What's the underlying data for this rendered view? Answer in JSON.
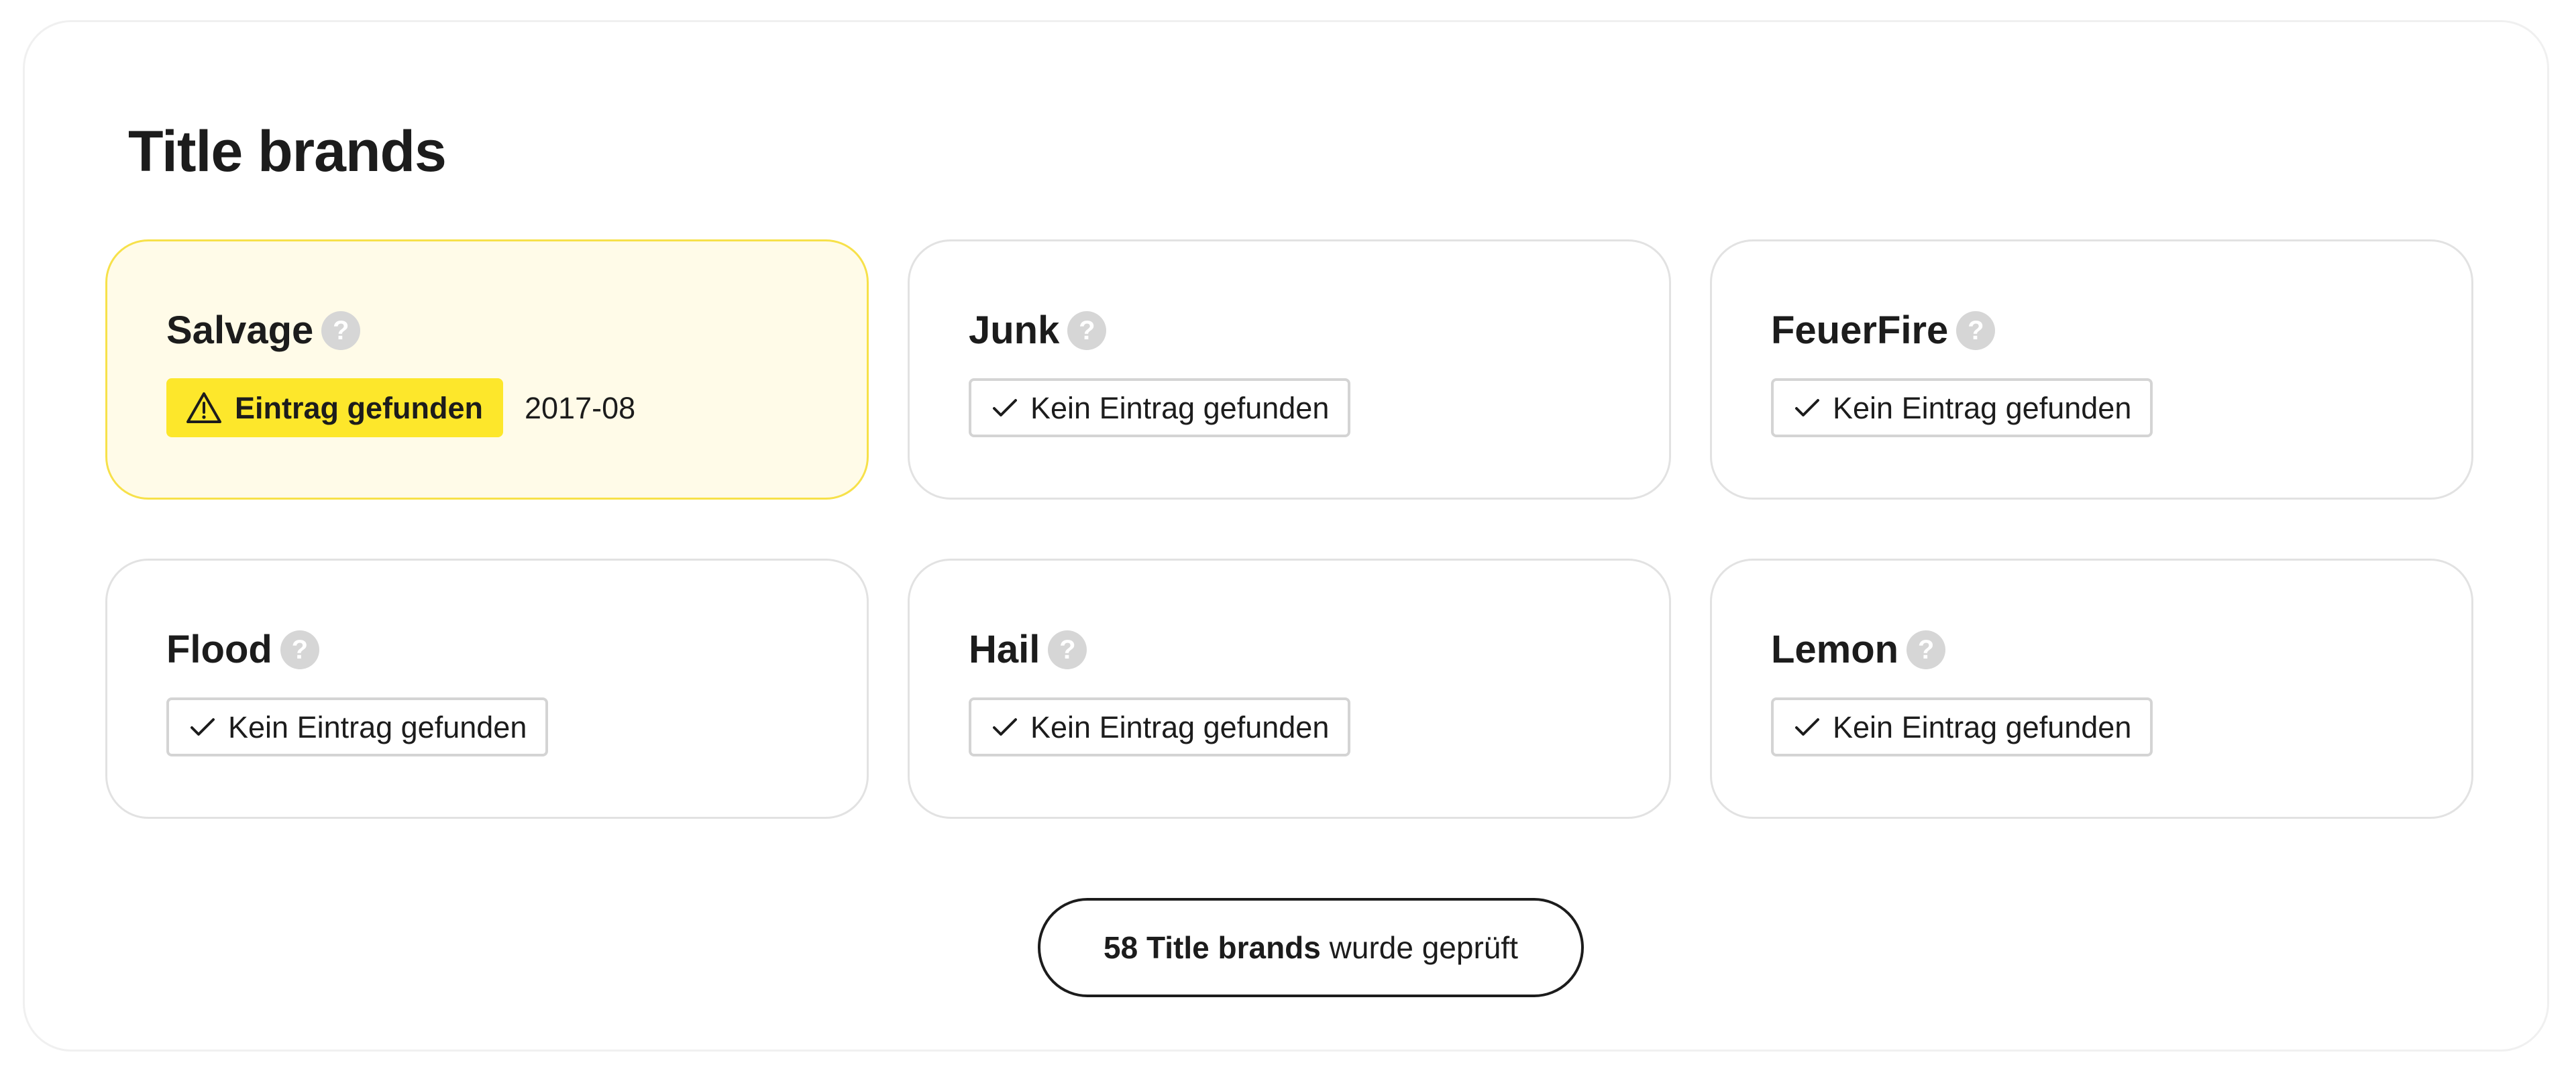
{
  "section": {
    "title": "Title brands"
  },
  "cards": [
    {
      "name": "Salvage",
      "status": "Eintrag gefunden",
      "date": "2017-08"
    },
    {
      "name": "Junk",
      "status": "Kein Eintrag gefunden"
    },
    {
      "name": "FeuerFire",
      "status": "Kein Eintrag gefunden"
    },
    {
      "name": "Flood",
      "status": "Kein Eintrag gefunden"
    },
    {
      "name": "Hail",
      "status": "Kein Eintrag gefunden"
    },
    {
      "name": "Lemon",
      "status": "Kein Eintrag gefunden"
    }
  ],
  "help_symbol": "?",
  "summary": {
    "count_label": "58 Title brands",
    "suffix": " wurde geprüft"
  },
  "icons": {
    "help": "help-icon",
    "found": "warning-triangle-icon",
    "ok": "checkmark-icon"
  },
  "colors": {
    "warning_card_bg": "#fffbe8",
    "warning_card_border": "#f7e14a",
    "warning_badge_bg": "#fde72b",
    "help_icon": "#d6d6d6",
    "card_border": "#e2e2e2",
    "text": "#1c1c1c"
  }
}
